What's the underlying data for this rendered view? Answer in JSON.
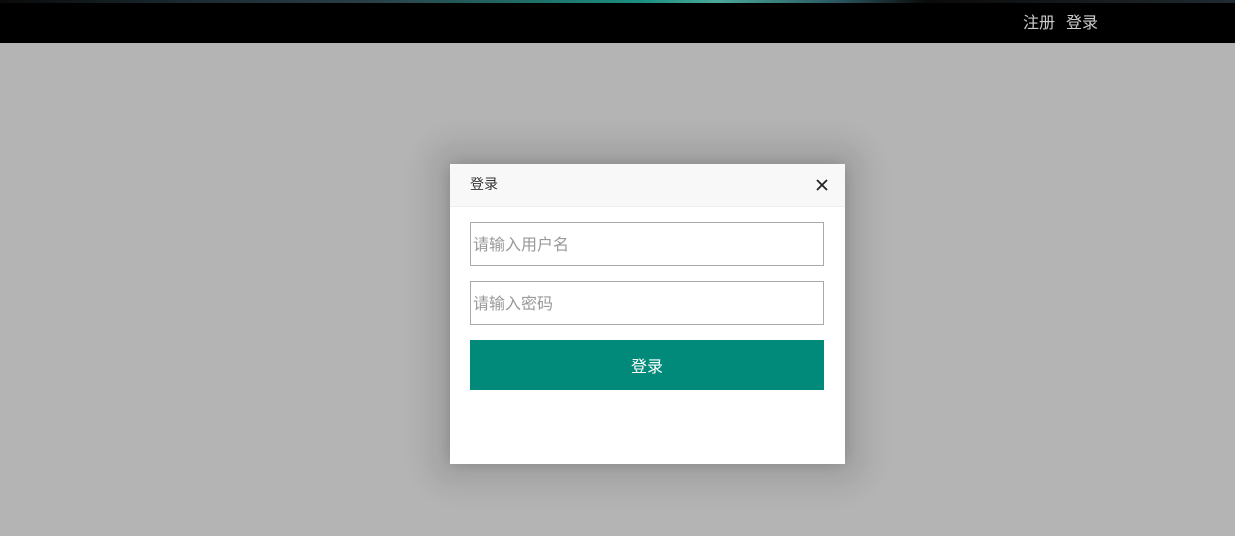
{
  "topbar": {
    "links": [
      {
        "label": "注册"
      },
      {
        "label": "登录"
      }
    ]
  },
  "modal": {
    "title": "登录",
    "close_icon": "close-icon",
    "username_placeholder": "请输入用户名",
    "password_placeholder": "请输入密码",
    "submit_label": "登录"
  },
  "colors": {
    "overlay": "#b4b4b4",
    "topbar": "#000000",
    "primary_button": "#01897a"
  }
}
